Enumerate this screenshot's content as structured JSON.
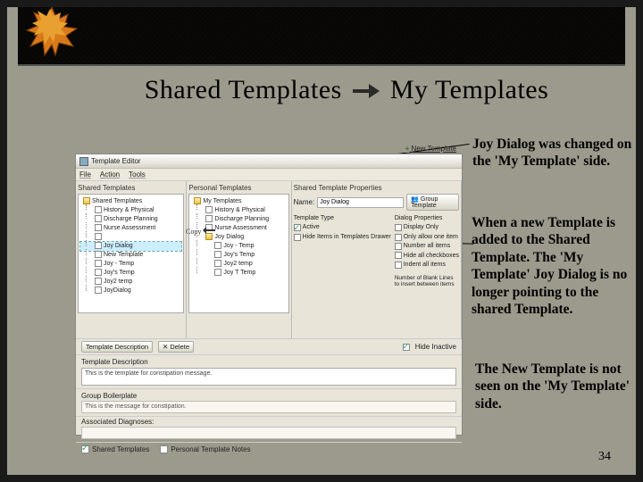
{
  "title_left": "Shared Templates",
  "title_right": "My Templates",
  "notes": {
    "n1": "Joy Dialog was changed on the 'My Template' side.",
    "n2": "When a new Template is added to the Shared Template. The 'My Template' Joy Dialog is no longer pointing to the shared Template.",
    "n3": "The New Template is not seen on the 'My Template' side."
  },
  "pagenum": "34",
  "editor": {
    "title": "Template Editor",
    "menu": {
      "file": "File",
      "action": "Action",
      "tools": "Tools"
    },
    "new_template": "New Template",
    "shared": {
      "header": "Shared Templates",
      "root": "Shared Templates",
      "items": [
        "History & Physical",
        "Discharge Planning",
        "Nurse Assessment",
        "",
        "Joy Dialog",
        "New Template",
        "Joy - Temp",
        "Joy's Temp",
        "Joy2 temp",
        "JoyDialog"
      ]
    },
    "personal": {
      "header": "Personal Templates",
      "root": "My Templates",
      "items": [
        "History & Physical",
        "Discharge Planning",
        "Nurse Assessment",
        "Joy Dialog",
        "Joy - Temp",
        "Joy's Temp",
        "Joy2 temp",
        "Joy T Temp"
      ]
    },
    "props": {
      "header": "Shared Template Properties",
      "name_label": "Name:",
      "name_value": "Joy Dialog",
      "template_type_label": "Template Type",
      "group_btn": "Group Template",
      "left": [
        "Active",
        "Hide Items in Templates Drawer"
      ],
      "right_header": "Dialog Properties",
      "right": [
        "Display Only",
        "Only allow one item",
        "Number all items",
        "Hide all checkboxes",
        "Indent all items"
      ]
    },
    "midbar": {
      "desc_btn": "Template Description",
      "delete_btn": "Delete",
      "hide_inactive": "Hide Inactive"
    },
    "blank_msg": "Number of Blank Lines to insert between items",
    "descfield": {
      "label": "Template Description",
      "value": "This is the template for constipation message."
    },
    "group": {
      "label": "Group Boilerplate",
      "value": "This is the message for constipation."
    },
    "associated": {
      "label": "Associated Diagnoses:",
      "value": ""
    },
    "footer": {
      "shared": "Shared Templates",
      "personal": "Personal Template Notes"
    },
    "copy_label": "Copy"
  },
  "chart_data": null
}
